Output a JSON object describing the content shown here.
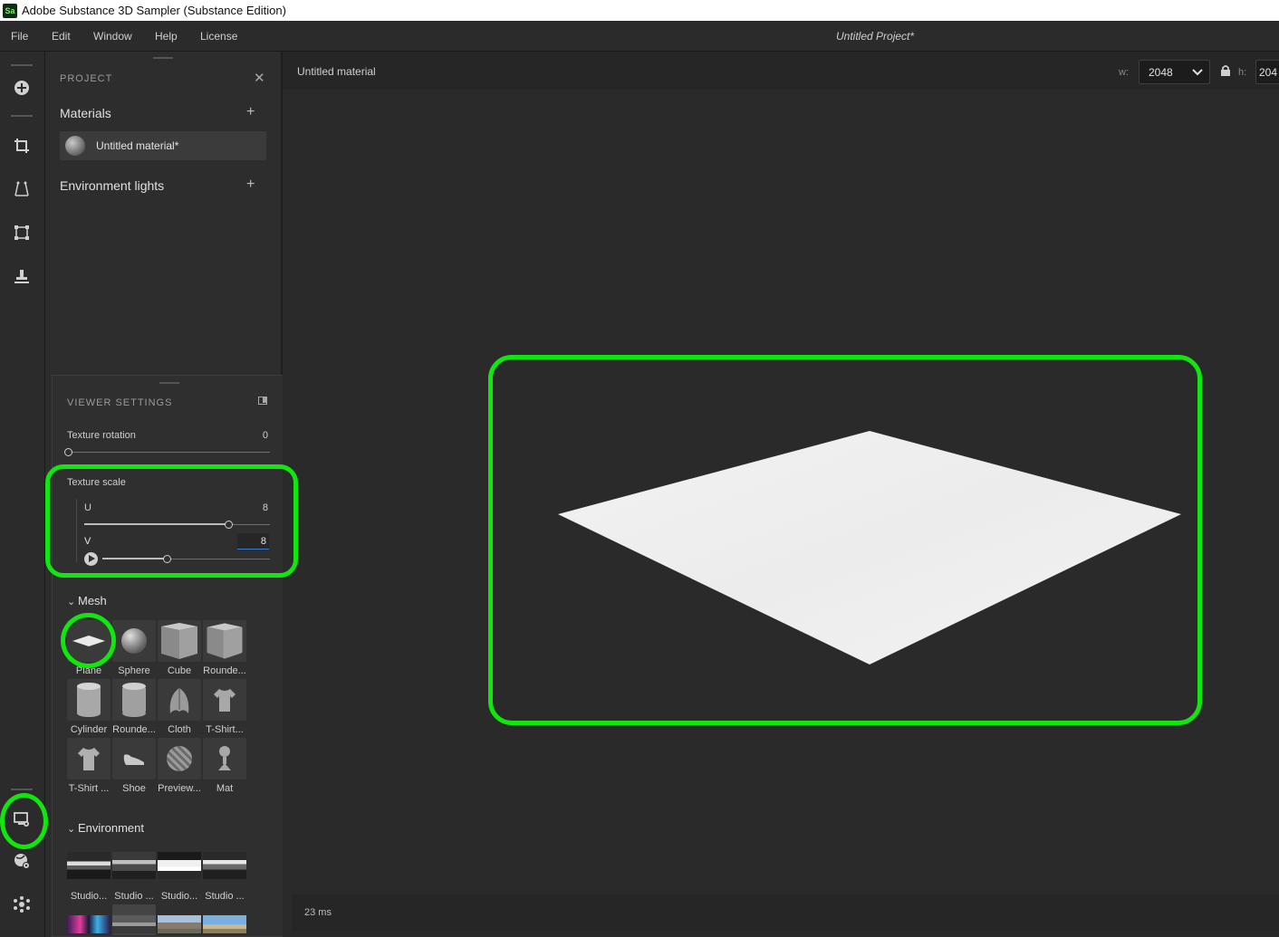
{
  "window": {
    "title": "Adobe Substance 3D Sampler (Substance Edition)",
    "logo_text": "Sa"
  },
  "menu": {
    "items": [
      "File",
      "Edit",
      "Window",
      "Help",
      "License"
    ],
    "project_title": "Untitled Project*"
  },
  "toolbar": {
    "top_icons": [
      "add-icon",
      "crop-icon",
      "perspective-icon",
      "transform-icon",
      "stamp-icon"
    ],
    "bottom_icons": [
      "viewer-settings-icon",
      "material-settings-icon",
      "plugins-icon"
    ]
  },
  "project": {
    "header": "PROJECT",
    "materials_title": "Materials",
    "material_item": "Untitled material*",
    "env_lights_title": "Environment lights",
    "plus_symbol": "+"
  },
  "viewer_settings": {
    "header": "VIEWER SETTINGS",
    "texture_rotation": {
      "label": "Texture rotation",
      "value": "0",
      "fraction": 0
    },
    "texture_scale": {
      "label": "Texture scale",
      "u": {
        "label": "U",
        "value": "8",
        "fraction": 0.78
      },
      "v": {
        "label": "V",
        "value": "8",
        "fraction": 0.39
      }
    },
    "mesh": {
      "title": "Mesh",
      "items": [
        "Plane",
        "Sphere",
        "Cube",
        "Rounde...",
        "Cylinder",
        "Rounde...",
        "Cloth",
        "T-Shirt...",
        "T-Shirt ...",
        "Shoe",
        "Preview...",
        "Mat"
      ],
      "selected": "Plane"
    },
    "environment": {
      "title": "Environment",
      "items": [
        "Studio...",
        "Studio ...",
        "Studio...",
        "Studio ..."
      ]
    }
  },
  "viewport": {
    "material_name": "Untitled material",
    "width_label": "w:",
    "width_value": "2048",
    "height_label": "h:",
    "height_value": "204",
    "status": "23 ms"
  },
  "colors": {
    "highlight": "#11e60e",
    "background": "#2a2a2a",
    "panel": "#2d2d2d"
  }
}
